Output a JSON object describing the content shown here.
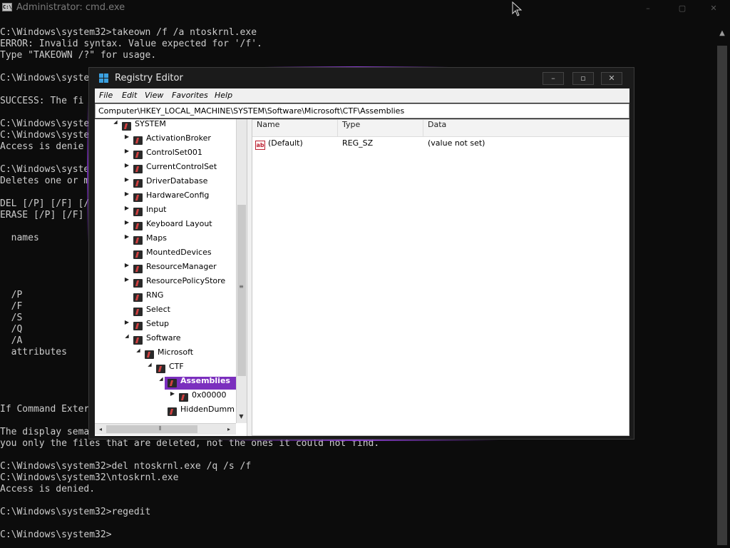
{
  "cmd": {
    "title": "Administrator: cmd.exe",
    "icon_label": "C:\\",
    "controls": {
      "minimize": "–",
      "maximize": "▢",
      "close": "✕"
    },
    "lines": [
      "C:\\Windows\\system32>takeown /f /a ntoskrnl.exe",
      "ERROR: Invalid syntax. Value expected for '/f'.",
      "Type \"TAKEOWN /?\" for usage.",
      "",
      "C:\\Windows\\syste",
      "",
      "SUCCESS: The fi",
      "",
      "C:\\Windows\\syste",
      "C:\\Windows\\syste",
      "Access is denie",
      "",
      "C:\\Windows\\syste",
      "Deletes one or m",
      "",
      "DEL [/P] [/F] [/",
      "ERASE [/P] [/F]",
      "",
      "  names",
      "",
      "",
      "",
      "",
      "  /P",
      "  /F",
      "  /S",
      "  /Q",
      "  /A",
      "  attributes",
      "",
      "",
      "",
      "",
      "If Command Exter",
      "",
      "The display sema",
      "you only the files that are deleted, not the ones it could not find.",
      "",
      "C:\\Windows\\system32>del ntoskrnl.exe /q /s /f",
      "C:\\Windows\\system32\\ntoskrnl.exe",
      "Access is denied.",
      "",
      "C:\\Windows\\system32>regedit",
      "",
      "C:\\Windows\\system32>"
    ]
  },
  "regedit": {
    "title": "Registry Editor",
    "controls": {
      "minimize": "–",
      "maximize": "▫",
      "close": "✕"
    },
    "menu": [
      "File",
      "Edit",
      "View",
      "Favorites",
      "Help"
    ],
    "address": "Computer\\HKEY_LOCAL_MACHINE\\SYSTEM\\Software\\Microsoft\\CTF\\Assemblies",
    "tree": [
      {
        "label": "SYSTEM",
        "depth": 0,
        "expander": "expanded"
      },
      {
        "label": "ActivationBroker",
        "depth": 1,
        "expander": "collapsed"
      },
      {
        "label": "ControlSet001",
        "depth": 1,
        "expander": "collapsed"
      },
      {
        "label": "CurrentControlSet",
        "depth": 1,
        "expander": "collapsed"
      },
      {
        "label": "DriverDatabase",
        "depth": 1,
        "expander": "collapsed"
      },
      {
        "label": "HardwareConfig",
        "depth": 1,
        "expander": "collapsed"
      },
      {
        "label": "Input",
        "depth": 1,
        "expander": "collapsed"
      },
      {
        "label": "Keyboard Layout",
        "depth": 1,
        "expander": "collapsed"
      },
      {
        "label": "Maps",
        "depth": 1,
        "expander": "collapsed"
      },
      {
        "label": "MountedDevices",
        "depth": 1,
        "expander": "none"
      },
      {
        "label": "ResourceManager",
        "depth": 1,
        "expander": "collapsed"
      },
      {
        "label": "ResourcePolicyStore",
        "depth": 1,
        "expander": "collapsed"
      },
      {
        "label": "RNG",
        "depth": 1,
        "expander": "none"
      },
      {
        "label": "Select",
        "depth": 1,
        "expander": "none"
      },
      {
        "label": "Setup",
        "depth": 1,
        "expander": "collapsed"
      },
      {
        "label": "Software",
        "depth": 1,
        "expander": "expanded"
      },
      {
        "label": "Microsoft",
        "depth": 2,
        "expander": "expanded"
      },
      {
        "label": "CTF",
        "depth": 3,
        "expander": "expanded"
      },
      {
        "label": "Assemblies",
        "depth": 4,
        "expander": "expanded",
        "selected": true
      },
      {
        "label": "0x00000",
        "depth": 5,
        "expander": "collapsed"
      },
      {
        "label": "HiddenDumm",
        "depth": 4,
        "expander": "none"
      }
    ],
    "list": {
      "columns": [
        "Name",
        "Type",
        "Data"
      ],
      "rows": [
        {
          "icon": "ab",
          "name": "(Default)",
          "type": "REG_SZ",
          "data": "(value not set)"
        }
      ]
    },
    "scroll_glyphs": {
      "up": "▲",
      "down": "▼",
      "left": "◂",
      "right": "▸",
      "vgrip": "≡",
      "hgrip": "⦀"
    }
  },
  "colors": {
    "console_bg": "#0c0c0c",
    "console_text": "#cccccc",
    "accent_purple": "#7b2fbe",
    "selection": "#7b2fbe"
  }
}
